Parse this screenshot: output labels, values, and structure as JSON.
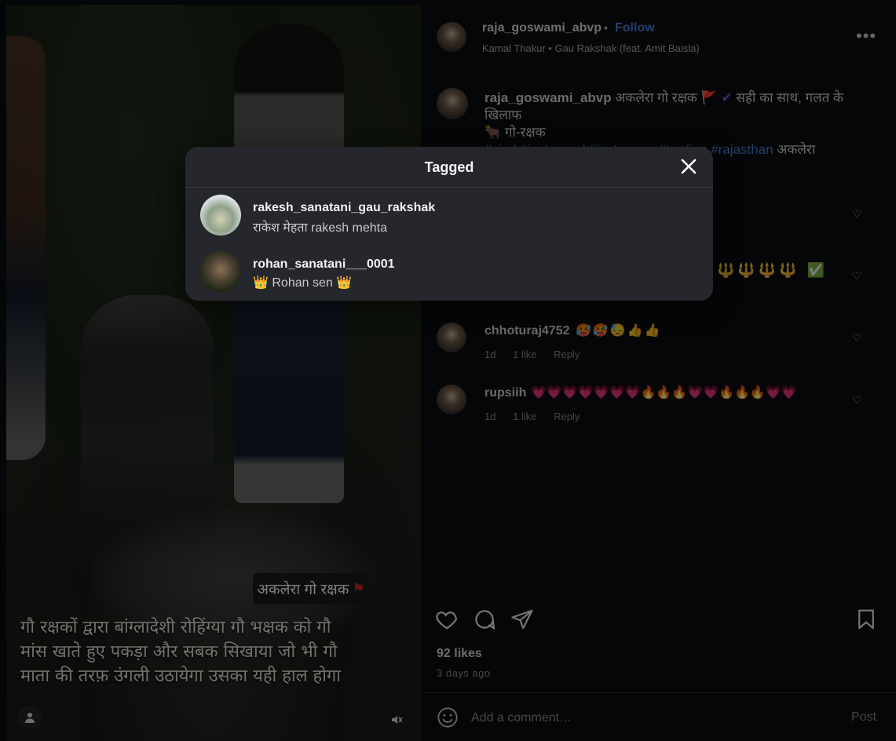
{
  "media": {
    "sticker_text": "अकलेरा गो रक्षक",
    "caption_lines": [
      "गौ रक्षकों द्वारा बांग्लादेशी रोहिंग्या गौ भक्षक को गौ",
      "मांस खाते हुए पकड़ा और सबक सिखाया जो भी गौ",
      "माता की तरफ़ उंगली उठायेगा उसका यही हाल होगा"
    ]
  },
  "header": {
    "username": "raja_goswami_abvp",
    "separator": "•",
    "follow_label": "Follow",
    "audio": "Kamal Thakur • Gau Rakshak (feat. Amit Baisla)",
    "more_icon": "more-horizontal-icon"
  },
  "caption": {
    "username": "raja_goswami_abvp",
    "text_line1": "अकलेरा गो रक्षक",
    "flag": "🚩",
    "tick": "✔",
    "text_line1b": "सही का साथ, गलत के खिलाफ",
    "text_line2": "🐂 गो-रक्षक",
    "hashtags": "#viral #instagood #instagram #treding #rajasthan",
    "text_tail": "अकलेरा"
  },
  "comments": [
    {
      "username": "chhoturaj4752",
      "text": "🥵🥵😓👍👍",
      "time": "1d",
      "likes": "1 like",
      "reply": "Reply"
    },
    {
      "username": "rupsiih",
      "text": "💗💗💗💗💗💗💗🔥🔥🔥💗💗🔥🔥🔥💗💗",
      "time": "1d",
      "likes": "1 like",
      "reply": "Reply"
    }
  ],
  "hidden_comment_tail": "🔱🔱🔱🔱",
  "hidden_comment_check": "✅",
  "stats": {
    "likes": "92 likes",
    "ago": "3 days ago"
  },
  "comment_box": {
    "placeholder": "Add a comment…",
    "post_label": "Post"
  },
  "modal": {
    "title": "Tagged",
    "people": [
      {
        "username": "rakesh_sanatani_gau_rakshak",
        "full_name": "राकेश मेहता rakesh mehta"
      },
      {
        "username": "rohan_sanatani___0001",
        "full_name_crown_left": "👑",
        "full_name": "Rohan sen",
        "full_name_crown_right": "👑"
      }
    ]
  },
  "colors": {
    "accent": "#4b7fd9",
    "modal_bg": "#26272c",
    "page_bg": "#0b0c0e"
  }
}
